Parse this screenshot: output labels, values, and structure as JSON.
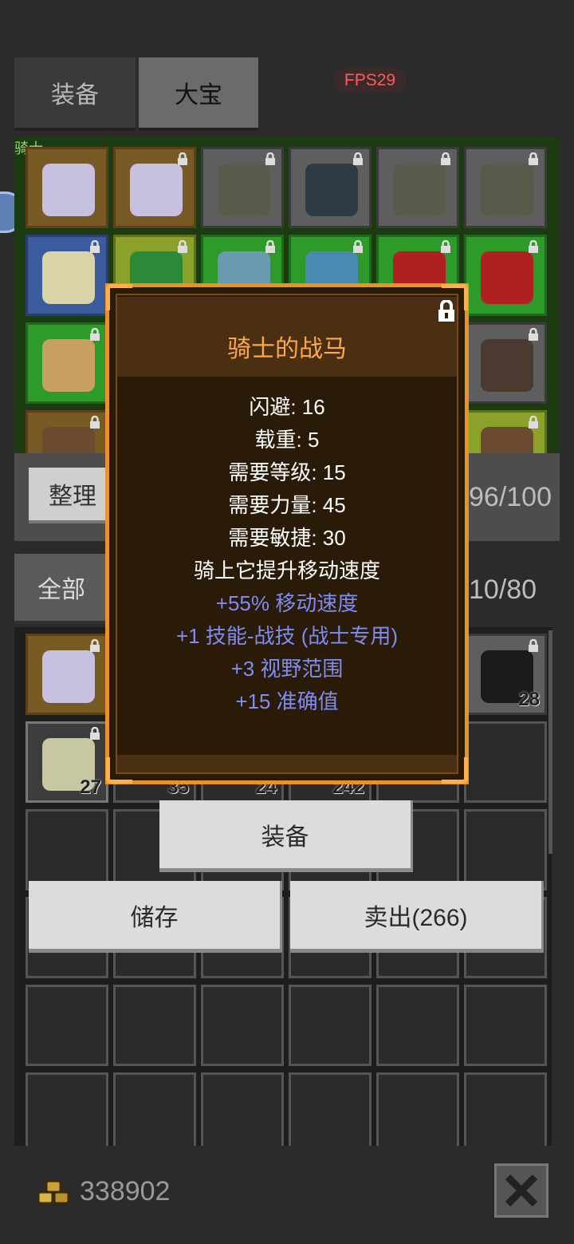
{
  "tabs": [
    {
      "label": "装备"
    },
    {
      "label": "大宝"
    }
  ],
  "fps": "FPS29",
  "equipment_panel": {
    "corner_label": "骑士",
    "rows": [
      [
        {
          "type": "orange",
          "lock": false,
          "icon": "horse-icon"
        },
        {
          "type": "orange",
          "lock": true,
          "icon": "horse-icon"
        },
        {
          "type": "gray",
          "lock": true,
          "icon": "helmet-icon"
        },
        {
          "type": "gray",
          "lock": true,
          "icon": "armor-icon"
        },
        {
          "type": "gray",
          "lock": true,
          "icon": "helmet-icon"
        },
        {
          "type": "gray",
          "lock": true,
          "icon": "helmet-icon"
        }
      ],
      [
        {
          "type": "blue",
          "lock": true,
          "icon": "amulet-icon"
        },
        {
          "type": "lime",
          "lock": true,
          "icon": "gem-icon"
        },
        {
          "type": "green",
          "lock": true,
          "icon": "ring-icon"
        },
        {
          "type": "green",
          "lock": true,
          "icon": "potion-icon"
        },
        {
          "type": "green",
          "lock": true,
          "icon": "sword-icon"
        },
        {
          "type": "green",
          "lock": true,
          "icon": "sword-icon"
        }
      ],
      [
        {
          "type": "green",
          "lock": true,
          "icon": "shield-icon"
        },
        {
          "type": "green",
          "lock": false,
          "icon": ""
        },
        {
          "type": "gray",
          "lock": false,
          "icon": ""
        },
        {
          "type": "gray",
          "lock": false,
          "icon": ""
        },
        {
          "type": "gray",
          "lock": false,
          "icon": ""
        },
        {
          "type": "gray",
          "lock": true,
          "icon": "mace-icon"
        }
      ],
      [
        {
          "type": "orange",
          "lock": true,
          "icon": "boot-icon"
        },
        {
          "type": "gray",
          "lock": false,
          "icon": ""
        },
        {
          "type": "gray",
          "lock": false,
          "icon": ""
        },
        {
          "type": "gray",
          "lock": false,
          "icon": ""
        },
        {
          "type": "gray",
          "lock": false,
          "icon": ""
        },
        {
          "type": "lime",
          "lock": true,
          "icon": "boot-icon"
        }
      ]
    ]
  },
  "sort_button": "整理",
  "equip_capacity": "96/100",
  "filter_all": "全部",
  "bag_capacity": "10/80",
  "inventory": {
    "row1": [
      {
        "type": "orange",
        "lock": true,
        "icon": "horse-icon",
        "count": ""
      },
      {
        "type": "gray",
        "lock": true,
        "icon": "ore-icon",
        "count": "28",
        "col": 5
      }
    ],
    "row2": [
      {
        "type": "dim",
        "lock": true,
        "icon": "herb-icon",
        "count": "27"
      },
      {
        "count": "35"
      },
      {
        "count": "24"
      },
      {
        "count": "242"
      }
    ]
  },
  "popup": {
    "title": "骑士的战马",
    "stats": [
      {
        "text": "闪避: 16",
        "kind": "white"
      },
      {
        "text": "载重: 5",
        "kind": "white"
      },
      {
        "text": "需要等级: 15",
        "kind": "white"
      },
      {
        "text": "需要力量: 45",
        "kind": "white"
      },
      {
        "text": "需要敏捷: 30",
        "kind": "white"
      },
      {
        "text": "骑上它提升移动速度",
        "kind": "white"
      },
      {
        "text": "+55% 移动速度",
        "kind": "blue"
      },
      {
        "text": "+1 技能-战技 (战士专用)",
        "kind": "blue"
      },
      {
        "text": "+3 视野范围",
        "kind": "blue"
      },
      {
        "text": "+15 准确值",
        "kind": "blue"
      }
    ]
  },
  "actions": {
    "equip": "装备",
    "store": "储存",
    "sell": "卖出(266)"
  },
  "gold": "338902",
  "colors": {
    "accent": "#e8922a",
    "title": "#ffa84a",
    "bonus": "#7f8df2",
    "fps": "#ff5a5a"
  }
}
